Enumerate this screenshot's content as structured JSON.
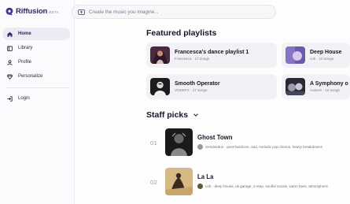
{
  "brand": {
    "name": "Riffusion",
    "badge": "BETA",
    "color": "#3b3b8f"
  },
  "sidebar": {
    "items": [
      {
        "label": "Home",
        "icon": "home-icon",
        "active": true
      },
      {
        "label": "Library",
        "icon": "library-icon",
        "active": false
      },
      {
        "label": "Profile",
        "icon": "profile-icon",
        "active": false
      },
      {
        "label": "Personalize",
        "icon": "personalize-icon",
        "active": false
      }
    ],
    "login": {
      "label": "Login",
      "icon": "login-icon"
    }
  },
  "search": {
    "placeholder": "Create the music you imagine...",
    "icon": "music-create-icon"
  },
  "featured": {
    "title": "Featured playlists",
    "cards": [
      {
        "title": "Francesca's dance playlist 1",
        "subtitle": "Francesca · 17 songs"
      },
      {
        "title": "Deep House",
        "subtitle": "cob · 10 songs"
      },
      {
        "title": "Smooth Operator",
        "subtitle": "VOXEFX · 17 songs"
      },
      {
        "title": "A Symphony o",
        "subtitle": "Autorre · 12 songs"
      }
    ]
  },
  "staff_picks": {
    "title": "Staff picks",
    "items": [
      {
        "rank": "01",
        "title": "Ghost Town",
        "tags": "Sendsedun · post-hardcore, sad, melodic pop chorus, heavy breakdowns"
      },
      {
        "rank": "02",
        "title": "La La",
        "tags": "cob · deep house, uk garage, 2-step, soulful vocals, warm bass, atmospheric"
      }
    ]
  },
  "colors": {
    "accent": "#3b3b8f",
    "active_bg": "#ebebf3",
    "card_bg": "#f1f1f6"
  }
}
